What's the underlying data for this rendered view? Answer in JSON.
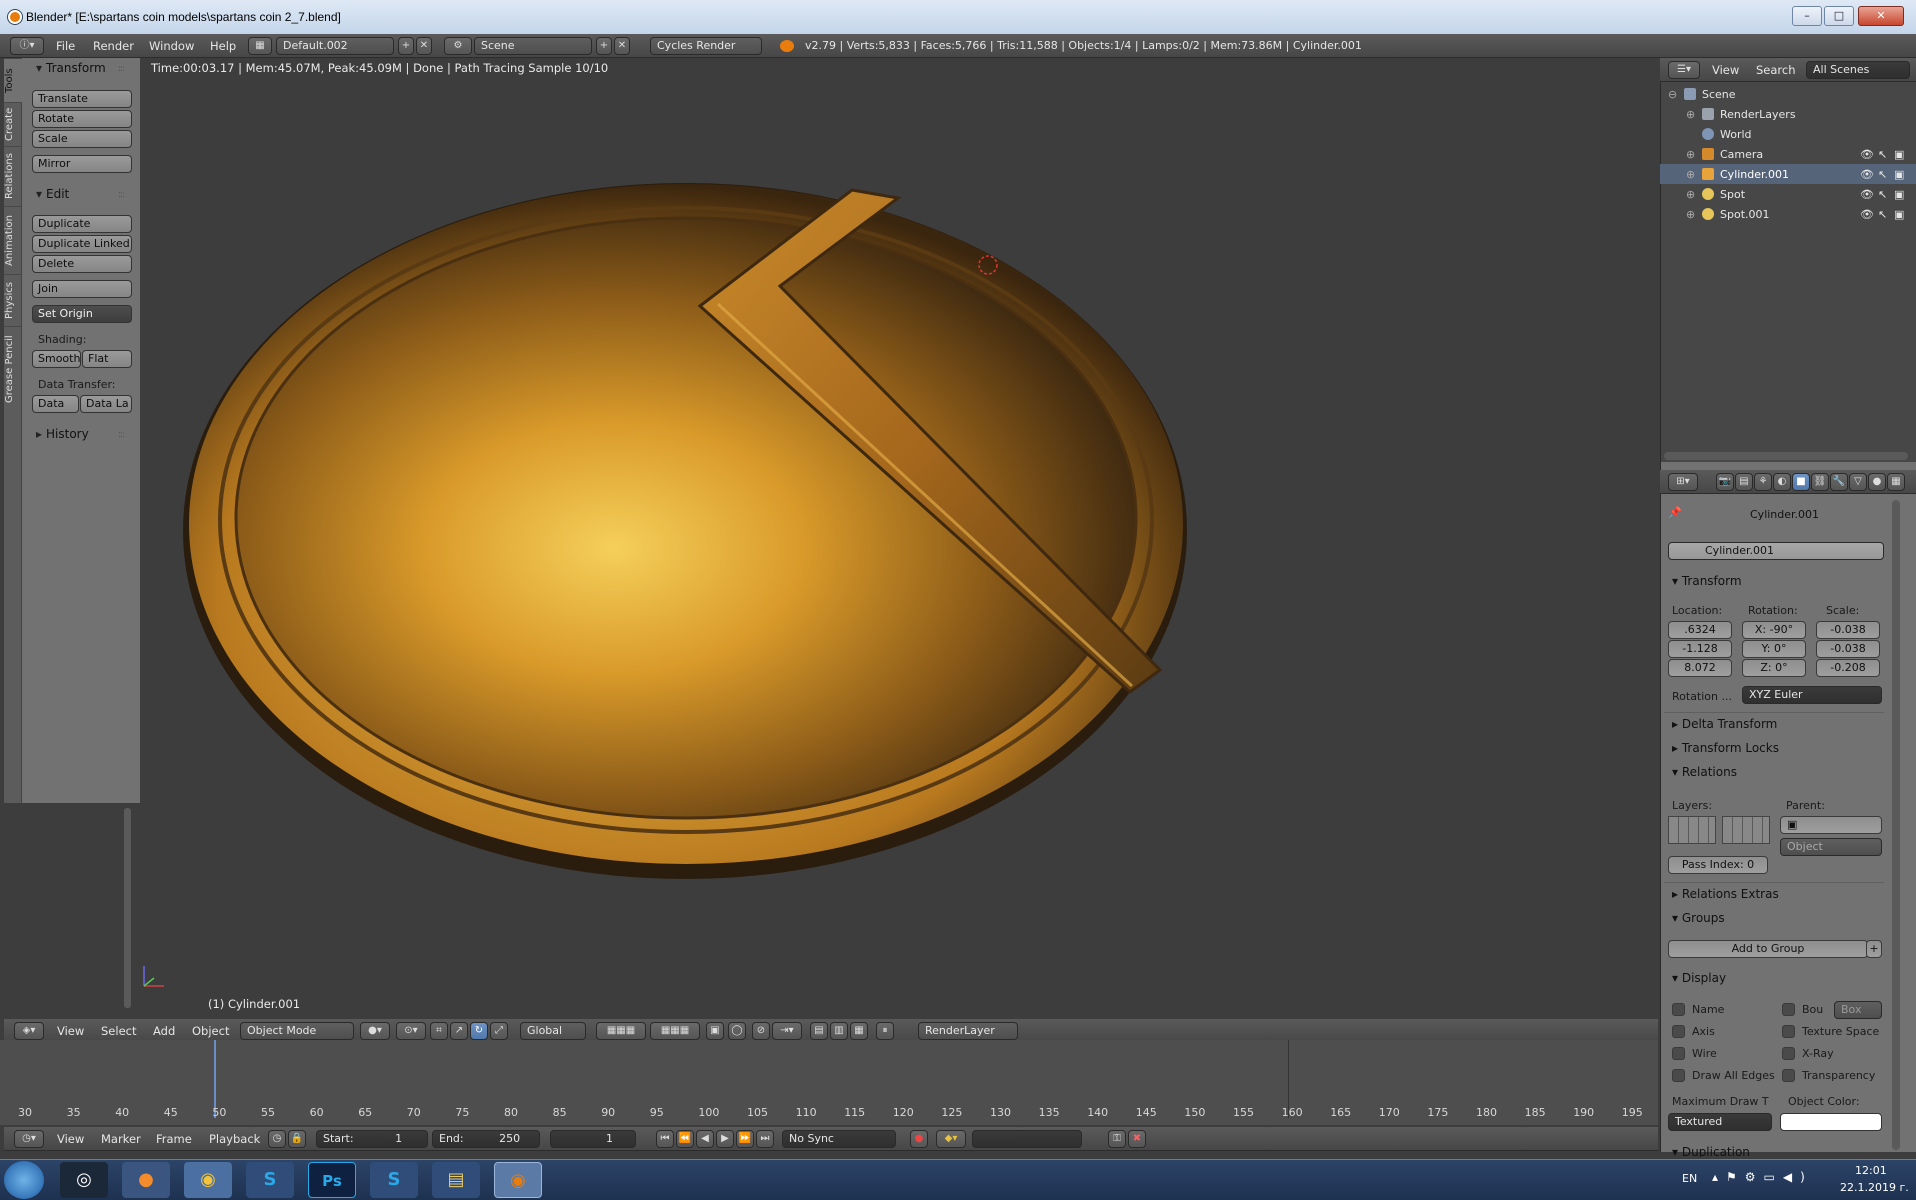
{
  "window": {
    "title": "Blender* [E:\\spartans coin models\\spartans coin 2_7.blend]",
    "controls": [
      "minimize",
      "maximize",
      "close"
    ]
  },
  "topbar": {
    "menus": [
      "File",
      "Render",
      "Window",
      "Help"
    ],
    "screen_layout": "Default.002",
    "scene": "Scene",
    "render_engine": "Cycles Render",
    "stats": "v2.79 | Verts:5,833 | Faces:5,766 | Tris:11,588 | Objects:1/4 | Lamps:0/2 | Mem:73.86M | Cylinder.001"
  },
  "tool_tabs": [
    "Tools",
    "Create",
    "Relations",
    "Animation",
    "Physics",
    "Grease Pencil"
  ],
  "tool_shelf": {
    "transform_title": "Transform",
    "transform_buttons": [
      "Translate",
      "Rotate",
      "Scale"
    ],
    "mirror": "Mirror",
    "edit_title": "Edit",
    "edit_buttons": [
      "Duplicate",
      "Duplicate Linked",
      "Delete"
    ],
    "join": "Join",
    "set_origin": "Set Origin",
    "shading_label": "Shading:",
    "shading_buttons": [
      "Smooth",
      "Flat"
    ],
    "data_transfer_label": "Data Transfer:",
    "data_transfer_buttons": [
      "Data",
      "Data La"
    ],
    "history_title": "History"
  },
  "viewport": {
    "render_info": "Time:00:03.17 | Mem:45.07M, Peak:45.09M | Done | Path Tracing Sample 10/10",
    "object_label": "(1) Cylinder.001"
  },
  "viewport_header": {
    "menus": [
      "View",
      "Select",
      "Add",
      "Object"
    ],
    "mode": "Object Mode",
    "orientation": "Global",
    "render_layer": "RenderLayer"
  },
  "outliner": {
    "header": [
      "View",
      "Search",
      "All Scenes"
    ],
    "items": [
      {
        "label": "Scene",
        "indent": 0,
        "icon": "scene-icon"
      },
      {
        "label": "RenderLayers",
        "indent": 1,
        "icon": "render-layers-icon"
      },
      {
        "label": "World",
        "indent": 1,
        "icon": "world-icon"
      },
      {
        "label": "Camera",
        "indent": 1,
        "icon": "camera-icon"
      },
      {
        "label": "Cylinder.001",
        "indent": 1,
        "icon": "mesh-icon",
        "selected": true
      },
      {
        "label": "Spot",
        "indent": 1,
        "icon": "lamp-icon"
      },
      {
        "label": "Spot.001",
        "indent": 1,
        "icon": "lamp-icon"
      }
    ]
  },
  "properties": {
    "breadcrumb": "Cylinder.001",
    "object_name": "Cylinder.001",
    "transform_title": "Transform",
    "location_label": "Location:",
    "rotation_label": "Rotation:",
    "scale_label": "Scale:",
    "location": [
      ".6324",
      "-1.128",
      "8.072"
    ],
    "rotation": [
      "X: -90°",
      "Y:   0°",
      "Z:   0°"
    ],
    "scale": [
      "-0.038",
      "-0.038",
      "-0.208"
    ],
    "rotation_mode_label": "Rotation ...",
    "rotation_mode": "XYZ Euler",
    "delta_transform": "Delta Transform",
    "transform_locks": "Transform Locks",
    "relations_title": "Relations",
    "layers_label": "Layers:",
    "parent_label": "Parent:",
    "parent_type": "Object",
    "pass_index_label": "Pass Index:",
    "pass_index": "0",
    "relations_extras": "Relations Extras",
    "groups_title": "Groups",
    "add_to_group": "Add to Group",
    "display_title": "Display",
    "display_left": [
      "Name",
      "Axis",
      "Wire",
      "Draw All Edges"
    ],
    "display_right": [
      "Bou",
      "Texture Space",
      "X-Ray",
      "Transparency"
    ],
    "bounds_type": "Box",
    "max_draw_label": "Maximum Draw T",
    "object_color_label": "Object Color:",
    "max_draw_value": "Textured",
    "duplication_title": "Duplication"
  },
  "timeline": {
    "ticks": [
      "30",
      "35",
      "40",
      "45",
      "50",
      "55",
      "60",
      "65",
      "70",
      "75",
      "80",
      "85",
      "90",
      "95",
      "100",
      "105",
      "110",
      "115",
      "120",
      "125",
      "130",
      "135",
      "140",
      "145",
      "150",
      "155",
      "160",
      "165",
      "170",
      "175",
      "180",
      "185",
      "190",
      "195"
    ],
    "menus": [
      "View",
      "Marker",
      "Frame",
      "Playback"
    ],
    "start_label": "Start:",
    "start": "1",
    "end_label": "End:",
    "end": "250",
    "current": "1",
    "sync": "No Sync"
  },
  "taskbar": {
    "apps": [
      "Start",
      "Steam",
      "Firefox",
      "Chrome",
      "Skype",
      "Photoshop",
      "Skype",
      "Explorer",
      "Blender"
    ],
    "language": "EN",
    "time": "12:01",
    "date": "22.1.2019 г."
  },
  "colors": {
    "accent": "#5077ab",
    "blender_orange": "#e87d0d",
    "coin_gold": "#d49a2a"
  }
}
